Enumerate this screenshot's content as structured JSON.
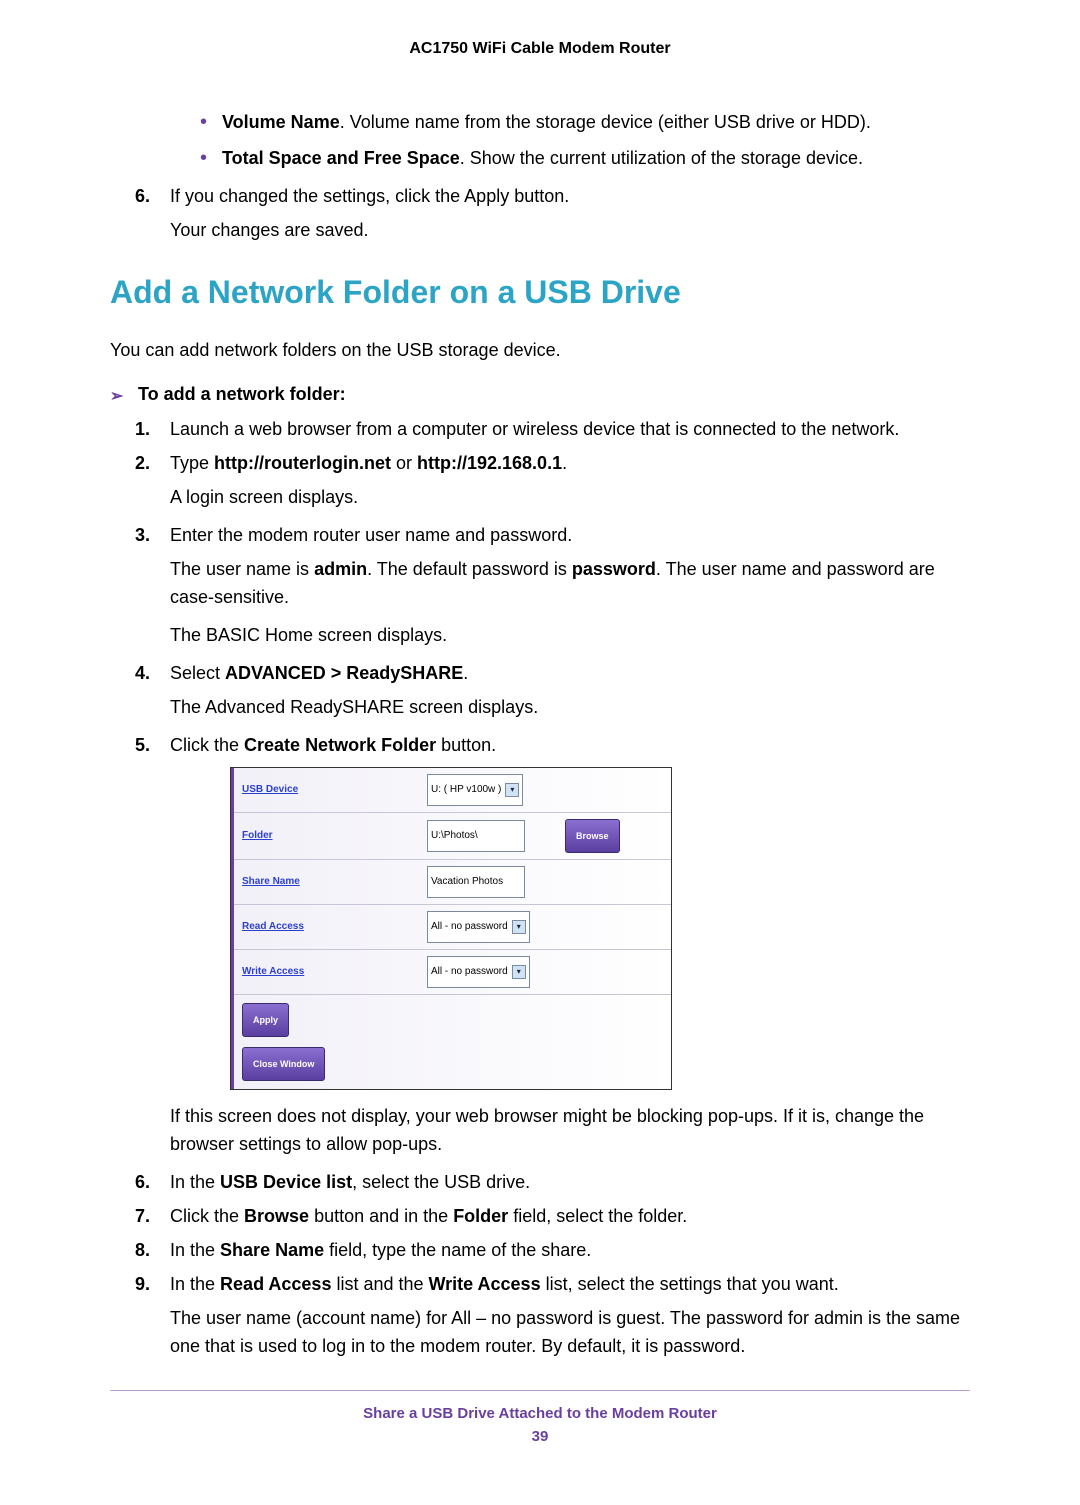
{
  "header": {
    "title": "AC1750 WiFi Cable Modem Router"
  },
  "top_bullets": [
    {
      "term": "Volume Name",
      "desc": ". Volume name from the storage device (either USB drive or HDD)."
    },
    {
      "term": "Total Space and Free Space",
      "desc": ". Show the current utilization of the storage device."
    }
  ],
  "top_steps": {
    "six": {
      "num": "6.",
      "text": "If you changed the settings, click the Apply button.",
      "sub": "Your changes are saved."
    }
  },
  "section_heading": "Add a Network Folder on a USB Drive",
  "intro": "You can add network folders on the USB storage device.",
  "procedure_heading": "To add a network folder:",
  "steps": {
    "s1": {
      "num": "1.",
      "text": "Launch a web browser from a computer or wireless device that is connected to the network."
    },
    "s2": {
      "num": "2.",
      "prefix": "Type ",
      "bold1": "http://routerlogin.net",
      "mid": " or ",
      "bold2": "http://192.168.0.1",
      "suffix": ".",
      "sub": "A login screen displays."
    },
    "s3": {
      "num": "3.",
      "text": "Enter the modem router user name and password.",
      "p2a": "The user name is ",
      "p2b": "admin",
      "p2c": ". The default password is ",
      "p2d": "password",
      "p2e": ". The user name and password are case-sensitive.",
      "p3": "The BASIC Home screen displays."
    },
    "s4": {
      "num": "4.",
      "prefix": "Select ",
      "bold": "ADVANCED > ReadySHARE",
      "suffix": ".",
      "sub": "The Advanced ReadySHARE screen displays."
    },
    "s5": {
      "num": "5.",
      "prefix": "Click the ",
      "bold": "Create Network Folder",
      "suffix": " button.",
      "after": "If this screen does not display, your web browser might be blocking pop-ups. If it is, change the browser settings to allow pop-ups."
    },
    "s6": {
      "num": "6.",
      "prefix": "In the ",
      "bold": "USB Device list",
      "suffix": ", select the USB drive."
    },
    "s7": {
      "num": "7.",
      "prefix": "Click the ",
      "bold1": "Browse",
      "mid": " button and in the ",
      "bold2": "Folder",
      "suffix": " field, select the folder."
    },
    "s8": {
      "num": "8.",
      "prefix": "In the ",
      "bold": "Share Name",
      "suffix": " field, type the name of the share."
    },
    "s9": {
      "num": "9.",
      "prefix": "In the ",
      "bold1": "Read Access",
      "mid": " list and the ",
      "bold2": "Write Access",
      "suffix": " list, select the settings that you want.",
      "p2": "The user name (account name) for All – no password is guest. The password for admin is the same one that is used to log in to the modem router. By default, it is password."
    }
  },
  "form": {
    "rows": {
      "usb": {
        "label": "USB Device",
        "value": "U: ( HP v100w )"
      },
      "folder": {
        "label": "Folder",
        "value": "U:\\Photos\\",
        "browse": "Browse"
      },
      "share": {
        "label": "Share Name",
        "value": "Vacation Photos"
      },
      "read": {
        "label": "Read Access",
        "value": "All - no password"
      },
      "write": {
        "label": "Write Access",
        "value": "All - no password"
      }
    },
    "apply": "Apply",
    "close": "Close Window"
  },
  "footer": {
    "text": "Share a USB Drive Attached to the Modem Router",
    "page": "39"
  }
}
